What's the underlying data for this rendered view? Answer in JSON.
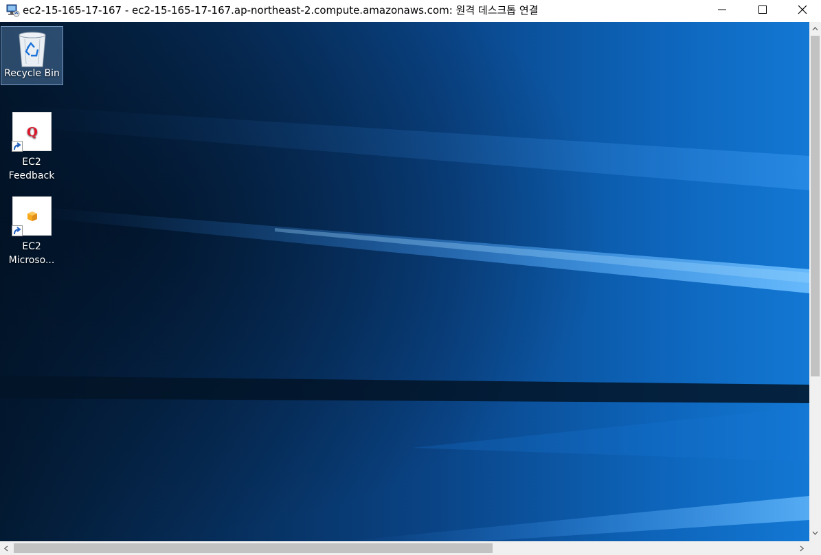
{
  "window": {
    "title": "ec2-15-165-17-167 - ec2-15-165-17-167.ap-northeast-2.compute.amazonaws.com: 원격 데스크톱 연결",
    "icon": "remote-desktop-icon",
    "controls": [
      "minimize",
      "maximize",
      "close"
    ]
  },
  "desktop": {
    "icons": [
      {
        "label": "Recycle Bin",
        "icon": "recycle-bin-icon",
        "selected": true
      },
      {
        "label_line1": "EC2",
        "label_line2": "Feedback",
        "icon": "feedback-q-icon",
        "shortcut": true
      },
      {
        "label_line1": "EC2",
        "label_line2": "Microso...",
        "icon": "aws-box-icon",
        "shortcut": true
      }
    ]
  },
  "colors": {
    "titlebar": "#ffffff",
    "desktop_accent": "#1378d4",
    "scrollbar_track": "#f0f0f0",
    "scrollbar_thumb": "#c2c2c2"
  }
}
